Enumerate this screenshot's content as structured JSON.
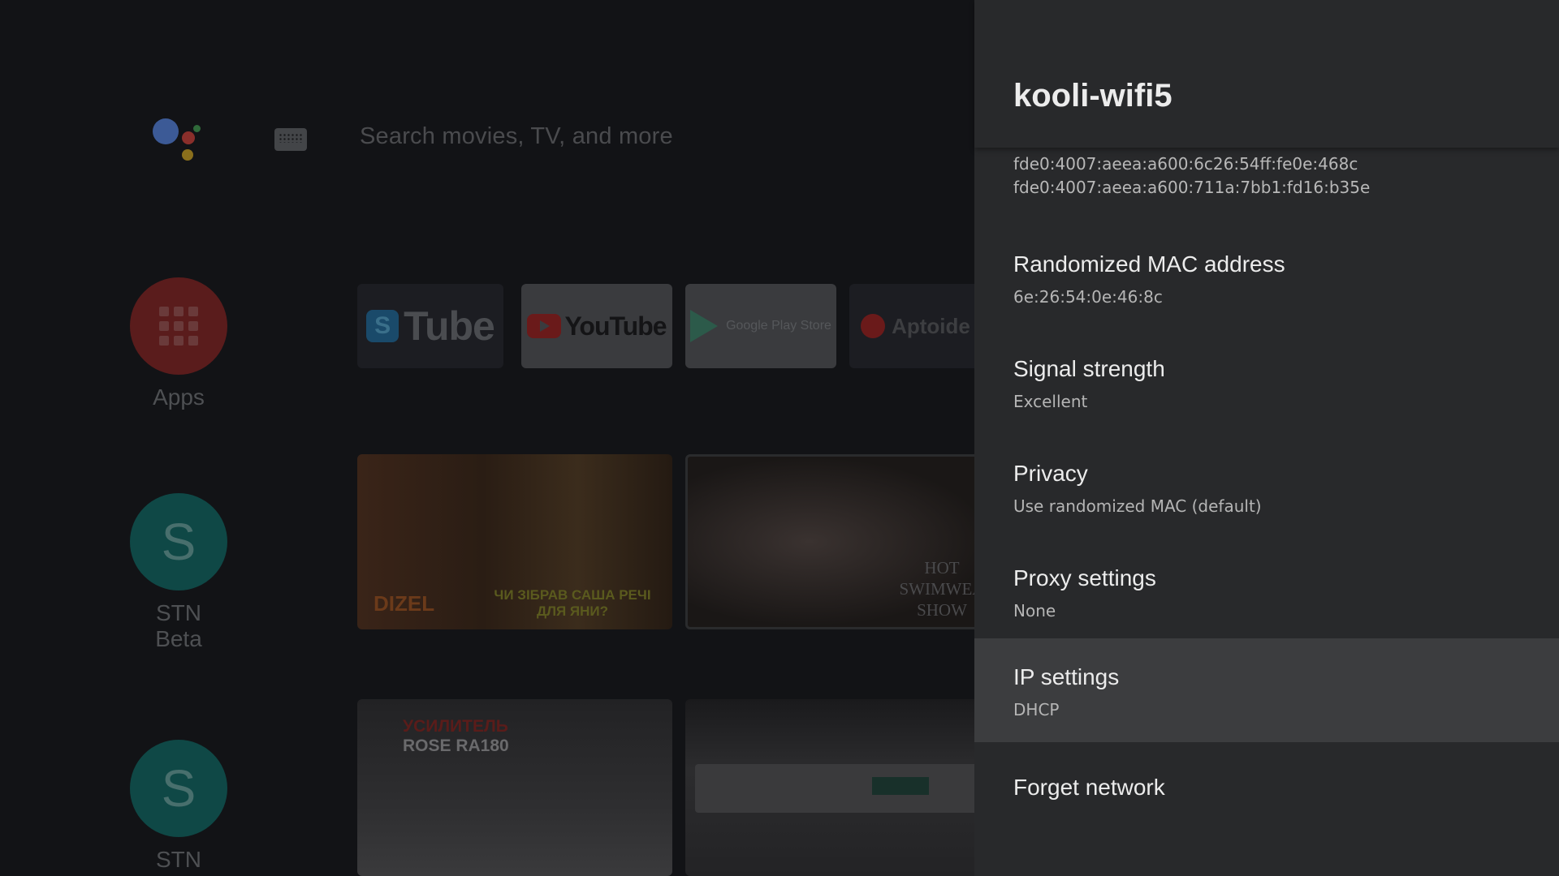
{
  "launcher": {
    "search_placeholder": "Search movies, TV, and more",
    "side_apps": [
      {
        "label": "Apps",
        "icon": "apps-grid-icon",
        "color": "#5a1c1c"
      },
      {
        "label": "STN Beta",
        "initial": "S",
        "color": "#0f4846"
      },
      {
        "label": "STN Beta",
        "initial": "S",
        "color": "#0f4846"
      }
    ],
    "app_tiles": [
      {
        "name": "stube-tile",
        "brand_initial": "S",
        "brand_word": "Tube"
      },
      {
        "name": "youtube-tile",
        "brand_word": "YouTube"
      },
      {
        "name": "google-play-store-tile",
        "brand_word": "Google Play Store"
      },
      {
        "name": "aptoide-tile",
        "brand_word": "Aptoide T"
      }
    ],
    "thumbnails": {
      "t1_brand": "DIZEL",
      "t1_caption": "ЧИ ЗІБРАВ САША РЕЧІ ДЛЯ ЯНИ?",
      "t2_caption": "HOT SWIMWEA SHOW",
      "t3_red": "УСИЛИТЕЛЬ",
      "t3_caption": "ROSE RA180"
    }
  },
  "panel": {
    "title": "kooli-wifi5",
    "ipv6_lines": [
      "fde0:4007:aeea:a600:6c26:54ff:fe0e:468c",
      "fde0:4007:aeea:a600:711a:7bb1:fd16:b35e"
    ],
    "items": [
      {
        "title": "Randomized MAC address",
        "subtitle": "6e:26:54:0e:46:8c"
      },
      {
        "title": "Signal strength",
        "subtitle": "Excellent"
      },
      {
        "title": "Privacy",
        "subtitle": "Use randomized MAC (default)"
      },
      {
        "title": "Proxy settings",
        "subtitle": "None"
      },
      {
        "title": "IP settings",
        "subtitle": "DHCP",
        "focused": true
      },
      {
        "title": "Forget network",
        "subtitle": ""
      }
    ]
  },
  "colors": {
    "panel_bg": "#28292b",
    "focused_row_bg": "#3c3d3f",
    "title_text": "#ececec",
    "subtitle_text": "#b5b5b5"
  }
}
